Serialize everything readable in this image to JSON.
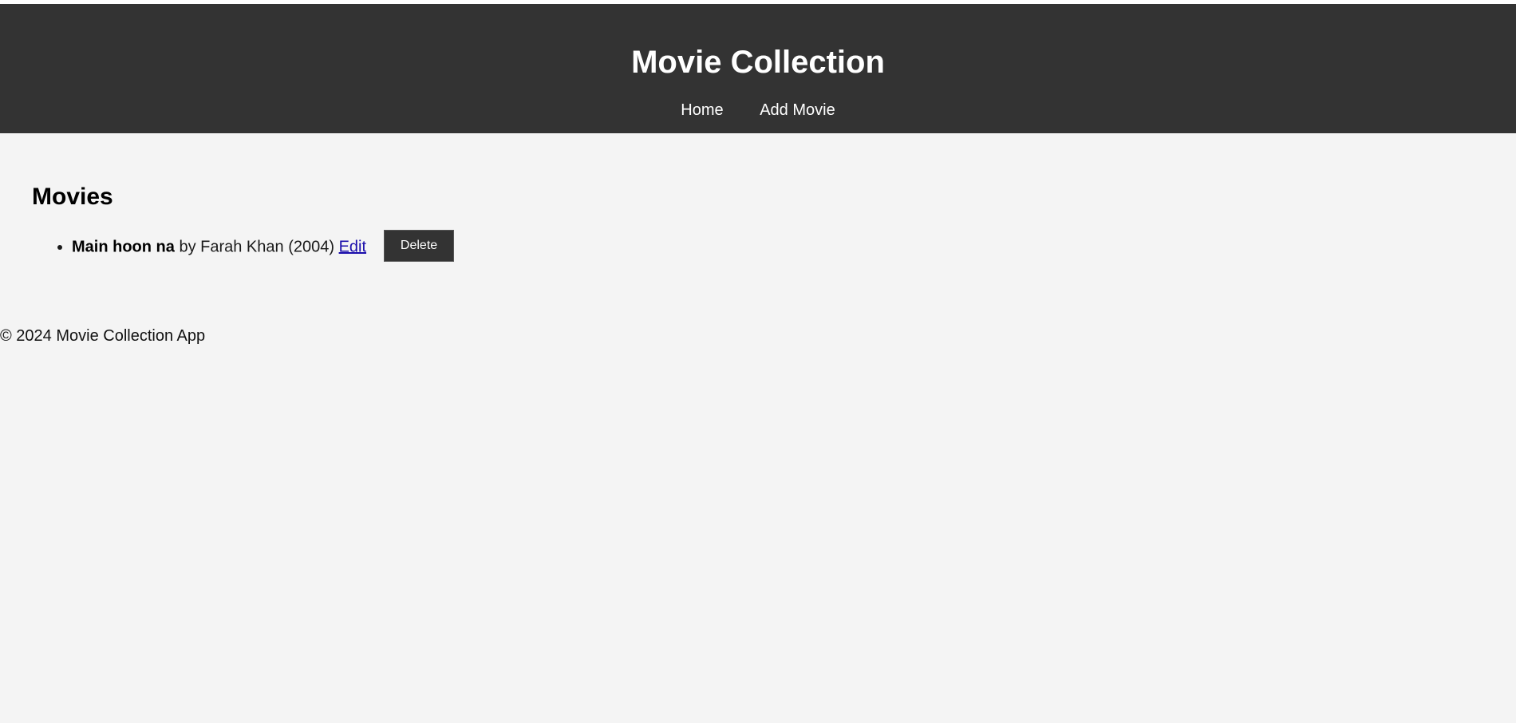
{
  "header": {
    "title": "Movie Collection",
    "nav": [
      {
        "label": "Home"
      },
      {
        "label": "Add Movie"
      }
    ]
  },
  "main": {
    "heading": "Movies",
    "movies": [
      {
        "title": "Main hoon na",
        "by_text": " by Farah Khan (2004) ",
        "edit_label": "Edit",
        "delete_label": "Delete"
      }
    ]
  },
  "footer": {
    "text": "© 2024 Movie Collection App"
  },
  "colors": {
    "header_bg": "#333333",
    "page_bg": "#f4f4f4",
    "link": "#1a0dab"
  }
}
